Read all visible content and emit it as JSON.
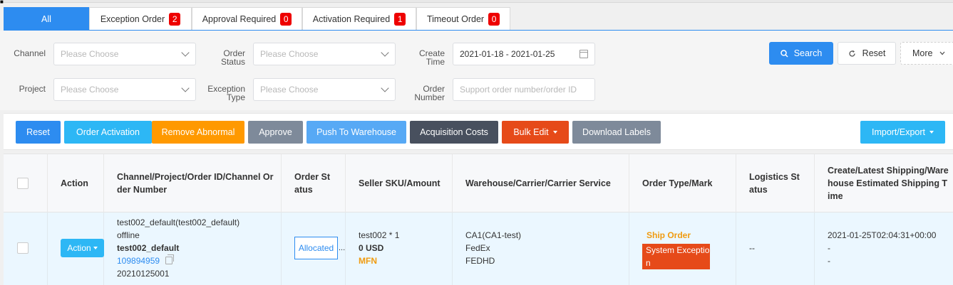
{
  "tabs": [
    {
      "label": "All",
      "count": ""
    },
    {
      "label": "Exception Order",
      "count": "2"
    },
    {
      "label": "Approval Required",
      "count": "0"
    },
    {
      "label": "Activation Required",
      "count": "1"
    },
    {
      "label": "Timeout Order",
      "count": "0"
    }
  ],
  "filters": {
    "channel_label": "Channel",
    "order_status_label_1": "Order",
    "order_status_label_2": "Status",
    "create_time_label_1": "Create",
    "create_time_label_2": "Time",
    "project_label": "Project",
    "exception_type_label_1": "Exception",
    "exception_type_label_2": "Type",
    "order_number_label_1": "Order",
    "order_number_label_2": "Number",
    "select_placeholder": "Please Choose",
    "date_range": "2021-01-18 - 2021-01-25",
    "order_number_placeholder": "Support order number/order ID",
    "search_label": "Search",
    "reset_label": "Reset",
    "more_label": "More"
  },
  "toolbar": {
    "reset": "Reset",
    "order_activation": "Order Activation",
    "remove_abnormal": "Remove Abnormal",
    "approve": "Approve",
    "push_to_warehouse": "Push To Warehouse",
    "acquisition_costs": "Acquisition Costs",
    "bulk_edit": "Bulk Edit",
    "download_labels": "Download Labels",
    "import_export": "Import/Export"
  },
  "colors": {
    "primary": "#2d8cf0",
    "info": "#2db7f5",
    "warning": "#ff9900",
    "danger": "#e64a19",
    "badge": "#ee0000"
  },
  "table": {
    "headers": {
      "action": "Action",
      "channel_1": "Channel/Project/Order ID/Channel Or",
      "channel_2": "der Number",
      "order_status_1": "Order St",
      "order_status_2": "atus",
      "seller_sku": "Seller SKU/Amount",
      "warehouse": "Warehouse/Carrier/Carrier Service",
      "order_type": "Order Type/Mark",
      "logistics_1": "Logistics St",
      "logistics_2": "atus",
      "create_1": "Create/Latest Shipping/Ware",
      "create_2": "house Estimated Shipping T",
      "create_3": "ime"
    },
    "row": {
      "action_label": "Action",
      "channel_project": "test002_default(test002_default)",
      "channel_type": "offline",
      "project": "test002_default",
      "order_id": "109894959",
      "channel_order_number": "20210125001",
      "order_status": "Allocated",
      "order_status_more": "...",
      "sku": "test002 * 1",
      "amount": "0 USD",
      "fulfillment": "MFN",
      "warehouse": "CA1(CA1-test)",
      "carrier": "FedEx",
      "carrier_service": "FEDHD",
      "order_type": "Ship Order",
      "mark_1": "System Exceptio",
      "mark_2": "n",
      "logistics_status": "--",
      "create_time": "2021-01-25T02:04:31+00:00",
      "latest_shipping": "-",
      "estimated_shipping": "-"
    }
  }
}
